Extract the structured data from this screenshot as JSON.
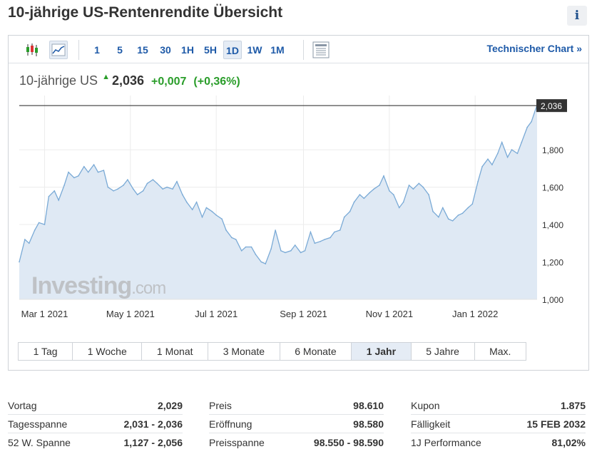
{
  "page": {
    "title": "10-jährige US-Rentenrendite Übersicht",
    "info_label": "i"
  },
  "toolbar": {
    "icons": [
      "candlestick-icon",
      "area-chart-icon",
      "table-view-icon"
    ],
    "timeframes": [
      "1",
      "5",
      "15",
      "30",
      "1H",
      "5H",
      "1D",
      "1W",
      "1M"
    ],
    "active_timeframe": "1D",
    "tech_chart_label": "Technischer Chart »"
  },
  "quote": {
    "name": "10-jährige US",
    "price": "2,036",
    "change": "+0,007",
    "change_pct": "(+0,36%)"
  },
  "chart_data": {
    "type": "area",
    "x_tick_labels": [
      "Mar 1 2021",
      "May 1 2021",
      "Jul 1 2021",
      "Sep 1 2021",
      "Nov 1 2021",
      "Jan 1 2022"
    ],
    "x_tick_dates": [
      "2021-03-01",
      "2021-05-01",
      "2021-07-01",
      "2021-09-01",
      "2021-11-01",
      "2022-01-01"
    ],
    "y_tick_labels": [
      "1,000",
      "1,200",
      "1,400",
      "1,600",
      "1,800"
    ],
    "y_ticks": [
      1.0,
      1.2,
      1.4,
      1.6,
      1.8
    ],
    "ylim": [
      1.0,
      2.09
    ],
    "xlim": [
      "2021-02-11",
      "2022-02-14"
    ],
    "last_value_label": "2,036",
    "last_value": 2.036,
    "watermark": "Investing.com",
    "grid": true,
    "colors": {
      "line": "#7aaad6",
      "fill": "#dfe9f4",
      "last_line": "#222222",
      "last_tag_bg": "#333333"
    },
    "x": [
      "2021-02-11",
      "2021-02-15",
      "2021-02-18",
      "2021-02-22",
      "2021-02-25",
      "2021-03-01",
      "2021-03-04",
      "2021-03-08",
      "2021-03-11",
      "2021-03-15",
      "2021-03-18",
      "2021-03-22",
      "2021-03-25",
      "2021-03-29",
      "2021-04-01",
      "2021-04-05",
      "2021-04-08",
      "2021-04-12",
      "2021-04-15",
      "2021-04-19",
      "2021-04-22",
      "2021-04-26",
      "2021-04-29",
      "2021-05-03",
      "2021-05-06",
      "2021-05-10",
      "2021-05-13",
      "2021-05-17",
      "2021-05-20",
      "2021-05-24",
      "2021-05-27",
      "2021-05-31",
      "2021-06-03",
      "2021-06-07",
      "2021-06-10",
      "2021-06-14",
      "2021-06-17",
      "2021-06-21",
      "2021-06-24",
      "2021-06-28",
      "2021-07-01",
      "2021-07-05",
      "2021-07-08",
      "2021-07-12",
      "2021-07-15",
      "2021-07-19",
      "2021-07-22",
      "2021-07-26",
      "2021-07-29",
      "2021-08-02",
      "2021-08-05",
      "2021-08-09",
      "2021-08-12",
      "2021-08-16",
      "2021-08-19",
      "2021-08-23",
      "2021-08-26",
      "2021-08-30",
      "2021-09-02",
      "2021-09-06",
      "2021-09-09",
      "2021-09-13",
      "2021-09-16",
      "2021-09-20",
      "2021-09-23",
      "2021-09-27",
      "2021-09-30",
      "2021-10-04",
      "2021-10-07",
      "2021-10-11",
      "2021-10-14",
      "2021-10-18",
      "2021-10-21",
      "2021-10-25",
      "2021-10-28",
      "2021-11-01",
      "2021-11-04",
      "2021-11-08",
      "2021-11-11",
      "2021-11-15",
      "2021-11-18",
      "2021-11-22",
      "2021-11-25",
      "2021-11-29",
      "2021-12-02",
      "2021-12-06",
      "2021-12-09",
      "2021-12-13",
      "2021-12-16",
      "2021-12-20",
      "2021-12-23",
      "2021-12-27",
      "2021-12-30",
      "2022-01-03",
      "2022-01-06",
      "2022-01-10",
      "2022-01-13",
      "2022-01-17",
      "2022-01-20",
      "2022-01-24",
      "2022-01-27",
      "2022-01-31",
      "2022-02-03",
      "2022-02-07",
      "2022-02-10",
      "2022-02-14"
    ],
    "values": [
      1.2,
      1.32,
      1.3,
      1.37,
      1.41,
      1.4,
      1.55,
      1.58,
      1.53,
      1.61,
      1.68,
      1.65,
      1.66,
      1.71,
      1.68,
      1.72,
      1.68,
      1.69,
      1.6,
      1.58,
      1.59,
      1.61,
      1.64,
      1.59,
      1.56,
      1.58,
      1.62,
      1.64,
      1.62,
      1.59,
      1.6,
      1.59,
      1.63,
      1.56,
      1.52,
      1.48,
      1.52,
      1.44,
      1.49,
      1.47,
      1.45,
      1.43,
      1.37,
      1.33,
      1.32,
      1.26,
      1.28,
      1.28,
      1.24,
      1.2,
      1.19,
      1.27,
      1.37,
      1.26,
      1.25,
      1.26,
      1.29,
      1.25,
      1.26,
      1.36,
      1.3,
      1.31,
      1.32,
      1.33,
      1.36,
      1.37,
      1.44,
      1.47,
      1.52,
      1.56,
      1.54,
      1.57,
      1.59,
      1.61,
      1.66,
      1.58,
      1.56,
      1.49,
      1.52,
      1.61,
      1.59,
      1.62,
      1.6,
      1.56,
      1.47,
      1.44,
      1.49,
      1.43,
      1.42,
      1.45,
      1.46,
      1.49,
      1.51,
      1.63,
      1.71,
      1.75,
      1.72,
      1.78,
      1.84,
      1.76,
      1.8,
      1.78,
      1.84,
      1.92,
      1.95,
      2.04
    ]
  },
  "ranges": {
    "items": [
      "1 Tag",
      "1 Woche",
      "1 Monat",
      "3 Monate",
      "6 Monate",
      "1 Jahr",
      "5 Jahre",
      "Max."
    ],
    "active": "1 Jahr"
  },
  "stats": {
    "col1": [
      {
        "label": "Vortag",
        "value": "2,029"
      },
      {
        "label": "Tagesspanne",
        "value": "2,031 - 2,036"
      },
      {
        "label": "52 W. Spanne",
        "value": "1,127 - 2,056"
      }
    ],
    "col2": [
      {
        "label": "Preis",
        "value": "98.610"
      },
      {
        "label": "Eröffnung",
        "value": "98.580"
      },
      {
        "label": "Preisspanne",
        "value": "98.550 - 98.590"
      }
    ],
    "col3": [
      {
        "label": "Kupon",
        "value": "1.875"
      },
      {
        "label": "Fälligkeit",
        "value": "15 FEB 2032"
      },
      {
        "label": "1J Performance",
        "value": "81,02%"
      }
    ]
  }
}
